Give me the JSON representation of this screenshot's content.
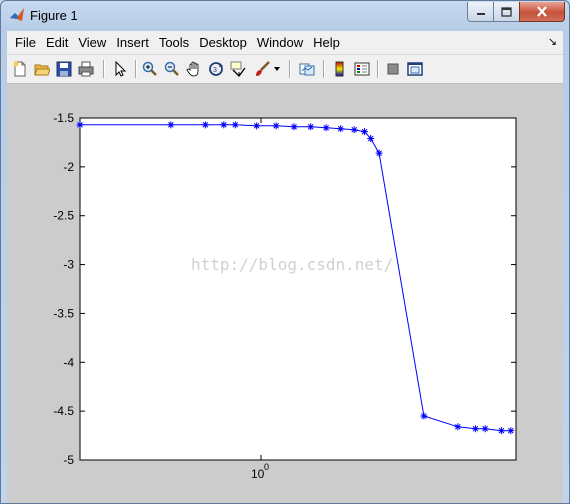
{
  "window": {
    "title": "Figure 1",
    "icon": "matlab-figure-icon"
  },
  "menubar": {
    "items": [
      "File",
      "Edit",
      "View",
      "Insert",
      "Tools",
      "Desktop",
      "Window",
      "Help"
    ]
  },
  "toolbar": {
    "buttons": [
      "new-figure-icon",
      "open-file-icon",
      "save-icon",
      "print-icon",
      "edit-plot-arrow-icon",
      "zoom-in-icon",
      "zoom-out-icon",
      "pan-hand-icon",
      "rotate-3d-icon",
      "data-cursor-icon",
      "brush-icon",
      "link-plot-icon",
      "insert-colorbar-icon",
      "insert-legend-icon",
      "hide-plot-tools-icon",
      "show-plot-tools-icon"
    ]
  },
  "watermark": "http://blog.csdn.net/",
  "chart_data": {
    "type": "line",
    "xscale": "log",
    "xlim": [
      0.5,
      3.5
    ],
    "ylim": [
      -5,
      -1.5
    ],
    "yticks": [
      -1.5,
      -2,
      -2.5,
      -3,
      -3.5,
      -4,
      -4.5,
      -5
    ],
    "ytick_labels": [
      "-1.5",
      "-2",
      "-2.5",
      "-3",
      "-3.5",
      "-4",
      "-4.5",
      "-5"
    ],
    "xtick_labels": [
      "10",
      "0"
    ],
    "line_color": "#0000ff",
    "marker": "*",
    "grid": false,
    "series": [
      {
        "x": [
          0.5,
          0.75,
          0.875,
          0.95,
          1.0,
          1.1,
          1.2,
          1.3,
          1.4,
          1.5,
          1.6,
          1.7,
          1.78,
          1.83,
          1.9,
          2.32,
          2.7,
          2.92,
          3.05,
          3.28,
          3.42
        ],
        "values": [
          -1.57,
          -1.57,
          -1.57,
          -1.57,
          -1.57,
          -1.58,
          -1.58,
          -1.59,
          -1.59,
          -1.6,
          -1.61,
          -1.62,
          -1.64,
          -1.71,
          -1.86,
          -4.55,
          -4.66,
          -4.68,
          -4.68,
          -4.7,
          -4.7
        ]
      }
    ]
  }
}
